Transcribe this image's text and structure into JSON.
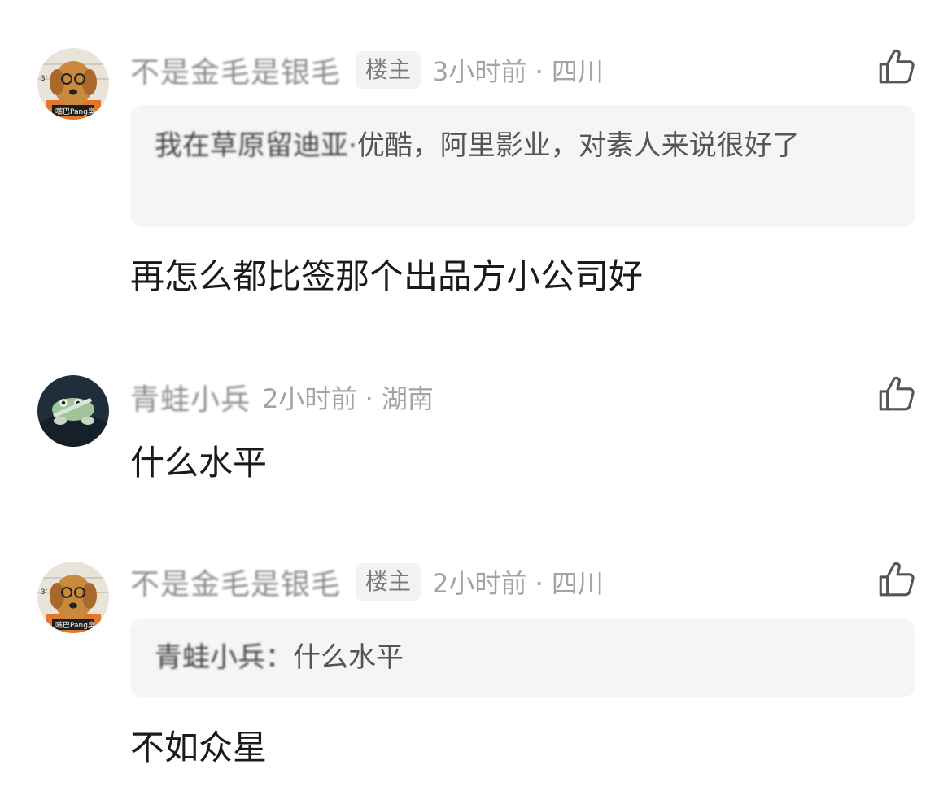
{
  "comments": [
    {
      "username": "不是金毛是银毛",
      "badge": "楼主",
      "time": "3小时前",
      "separator": "·",
      "location": "四川",
      "avatar_icon": "golden-retriever-avatar",
      "quote_prefix": "我在草原留迪亚·",
      "quote_text": "优酷，阿里影业，对素人来说很好了",
      "text": "再怎么都比签那个出品方小公司好"
    },
    {
      "username": "青蛙小兵",
      "time": "2小时前",
      "separator": "·",
      "location": "湖南",
      "avatar_icon": "frog-avatar",
      "text": "什么水平"
    },
    {
      "username": "不是金毛是银毛",
      "badge": "楼主",
      "time": "2小时前",
      "separator": "·",
      "location": "四川",
      "avatar_icon": "golden-retriever-avatar",
      "quote_prefix": "青蛙小兵：",
      "quote_text": "什么水平",
      "text": "不如众星"
    }
  ],
  "icons": {
    "like": "thumbs-up-icon"
  },
  "colors": {
    "username": "#8c8c8c",
    "meta": "#a3a3a3",
    "quote_bg": "#f5f5f5",
    "text": "#1a1a1a"
  }
}
